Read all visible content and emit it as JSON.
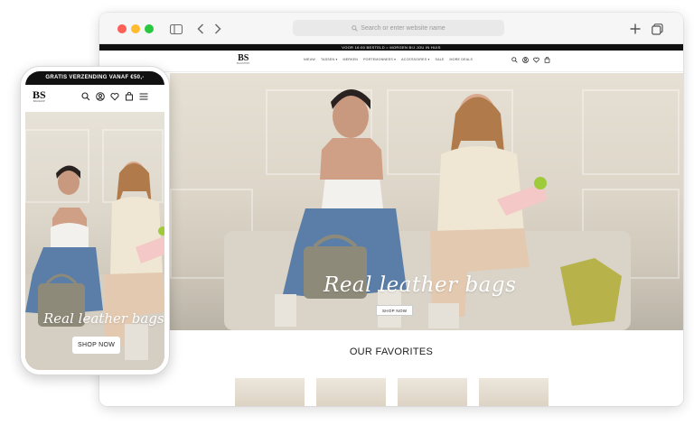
{
  "browser": {
    "address_placeholder": "Search or enter website name"
  },
  "site": {
    "promo_text": "VOOR 16:00 BESTELD = MORGEN BIJ JOU IN HUIS",
    "logo": "BS",
    "logo_sub": "BAGSHOP",
    "menu": [
      "NIEUW",
      "TASSEN ▾",
      "MERKEN",
      "PORTEMONNEES ▾",
      "ACCESSOIRES ▾",
      "SALE",
      "MORE DEALS"
    ],
    "hero_title": "Real leather bags",
    "hero_button": "SHOP NOW",
    "favorites_heading": "OUR FAVORITES",
    "cart_count": "0"
  },
  "mobile": {
    "promo_text": "GRATIS VERZENDING VANAF €50,-",
    "logo": "BS",
    "logo_sub": "BAGSHOP",
    "hero_title": "Real leather bags",
    "hero_button": "SHOP NOW"
  },
  "icons": [
    "sidebar-icon",
    "back-icon",
    "forward-icon",
    "search-icon",
    "account-icon",
    "heart-icon",
    "cart-icon",
    "menu-icon",
    "plus-icon",
    "tabs-icon"
  ],
  "colors": {
    "traffic_red": "#fe5f57",
    "traffic_yellow": "#febc2e",
    "traffic_green": "#28c840",
    "promo_bar": "#111111"
  }
}
